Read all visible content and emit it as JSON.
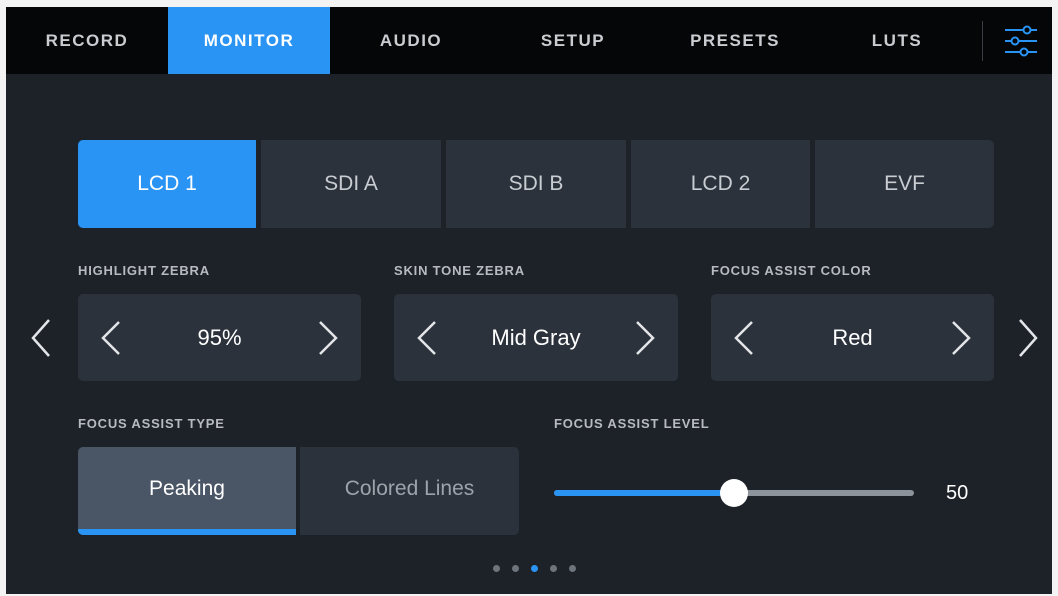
{
  "tabs": [
    {
      "label": "RECORD"
    },
    {
      "label": "MONITOR"
    },
    {
      "label": "AUDIO"
    },
    {
      "label": "SETUP"
    },
    {
      "label": "PRESETS"
    },
    {
      "label": "LUTS"
    }
  ],
  "active_tab": "MONITOR",
  "settings_icon": "sliders-icon",
  "outputs": [
    {
      "label": "LCD 1"
    },
    {
      "label": "SDI A"
    },
    {
      "label": "SDI B"
    },
    {
      "label": "LCD 2"
    },
    {
      "label": "EVF"
    }
  ],
  "active_output": "LCD 1",
  "highlight_zebra": {
    "label": "HIGHLIGHT ZEBRA",
    "value": "95%"
  },
  "skin_tone_zebra": {
    "label": "SKIN TONE ZEBRA",
    "value": "Mid Gray"
  },
  "focus_assist_color": {
    "label": "FOCUS ASSIST COLOR",
    "value": "Red"
  },
  "focus_assist_type": {
    "label": "FOCUS ASSIST TYPE",
    "options": [
      "Peaking",
      "Colored Lines"
    ],
    "selected": "Peaking"
  },
  "focus_assist_level": {
    "label": "FOCUS ASSIST LEVEL",
    "value": "50",
    "min": 0,
    "max": 100
  },
  "pagination": {
    "count": 5,
    "current_index": 2
  },
  "colors": {
    "accent": "#2a94f4",
    "background": "#1d2229",
    "tab_bar": "#050607",
    "control": "#2b323c"
  }
}
